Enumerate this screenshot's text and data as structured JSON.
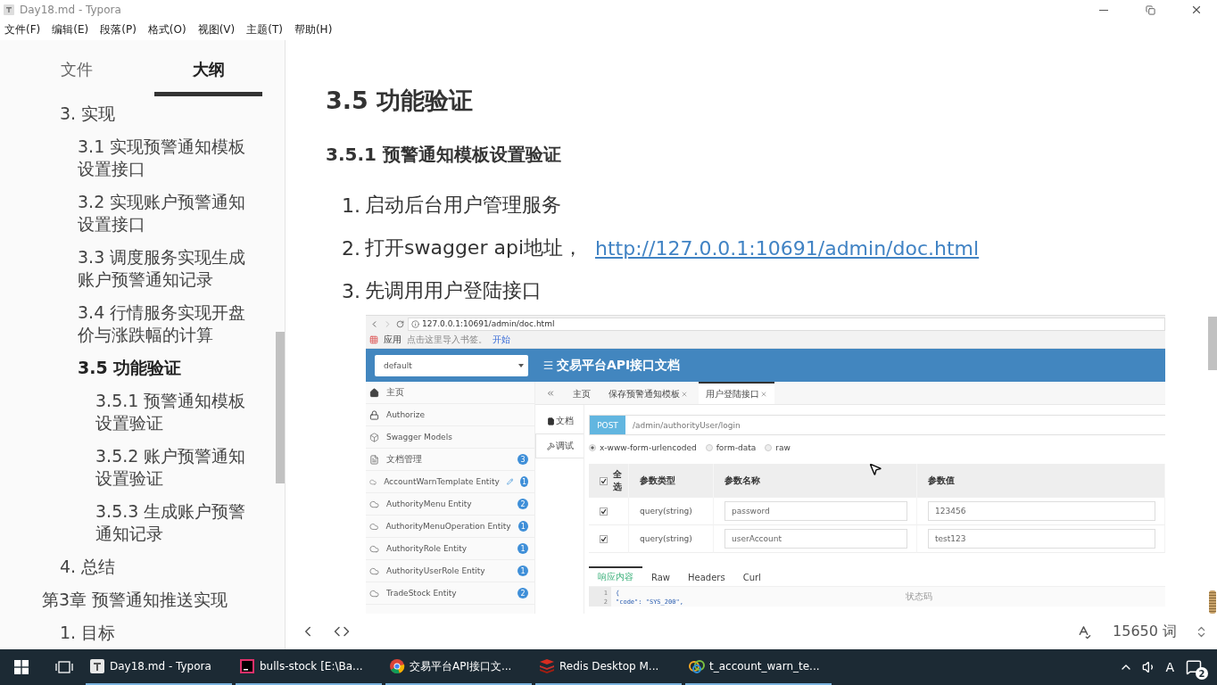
{
  "window": {
    "title": "Day18.md - Typora"
  },
  "menu": [
    "文件(F)",
    "编辑(E)",
    "段落(P)",
    "格式(O)",
    "视图(V)",
    "主题(T)",
    "帮助(H)"
  ],
  "sidebar": {
    "tabs": [
      {
        "label": "文件",
        "selected": false
      },
      {
        "label": "大纲",
        "selected": true
      }
    ],
    "outline": [
      {
        "kind": "section",
        "text": "3. 实现",
        "selected": false,
        "children": [
          {
            "text": "3.1 实现预警通知模板设置接口",
            "selected": false
          },
          {
            "text": "3.2 实现账户预警通知设置接口",
            "selected": false
          },
          {
            "text": "3.3 调度服务实现生成账户预警通知记录",
            "selected": false
          },
          {
            "text": "3.4 行情服务实现开盘价与涨跌幅的计算",
            "selected": false
          },
          {
            "text": "3.5 功能验证",
            "selected": true,
            "children": [
              {
                "text": "3.5.1 预警通知模板设置验证",
                "selected": false
              },
              {
                "text": "3.5.2 账户预警通知设置验证",
                "selected": false
              },
              {
                "text": "3.5.3 生成账户预警通知记录",
                "selected": false
              }
            ]
          }
        ]
      },
      {
        "kind": "section",
        "text": "4. 总结",
        "selected": false
      },
      {
        "kind": "chapter",
        "text": "第3章 预警通知推送实现",
        "selected": false,
        "children": [
          {
            "text": "1. 目标",
            "selected": false
          }
        ]
      }
    ]
  },
  "document": {
    "heading": "3.5  功能验证",
    "subheading": "3.5.1 预警通知模板设置验证",
    "steps": [
      {
        "number": "1.",
        "text": "启动后台用户管理服务"
      },
      {
        "number": "2.",
        "text": "打开swagger api地址，",
        "link": "http://127.0.0.1:10691/admin/doc.html"
      },
      {
        "number": "3.",
        "text": "先调用用户登陆接口"
      }
    ],
    "screenshot": {
      "url": "127.0.0.1:10691/admin/doc.html",
      "bookmarks": {
        "apps": "应用",
        "hint": "点击这里导入书签。",
        "link": "开始"
      },
      "group_select": "default",
      "title": "交易平台API接口文档",
      "menu": [
        {
          "label": "主页",
          "kind": "home",
          "edited": false
        },
        {
          "label": "Authorize",
          "kind": "lock",
          "edited": false
        },
        {
          "label": "Swagger Models",
          "kind": "models",
          "edited": false
        },
        {
          "label": "文档管理",
          "kind": "docs",
          "badge": "3",
          "edited": false
        },
        {
          "label": "AccountWarnTemplate Entity",
          "kind": "entity",
          "badge": "1",
          "edited": true
        },
        {
          "label": "AuthorityMenu Entity",
          "kind": "entity",
          "badge": "2",
          "edited": false
        },
        {
          "label": "AuthorityMenuOperation Entity",
          "kind": "entity",
          "badge": "1",
          "edited": false
        },
        {
          "label": "AuthorityRole Entity",
          "kind": "entity",
          "badge": "1",
          "edited": false
        },
        {
          "label": "AuthorityUserRole Entity",
          "kind": "entity",
          "badge": "1",
          "edited": false
        },
        {
          "label": "TradeStock Entity",
          "kind": "entity",
          "badge": "2",
          "edited": false
        }
      ],
      "tabs": [
        {
          "label": "主页",
          "closable": false,
          "selected": false
        },
        {
          "label": "保存预警通知模板",
          "closable": true,
          "selected": false
        },
        {
          "label": "用户登陆接口",
          "closable": true,
          "selected": true
        }
      ],
      "side_tabs": [
        {
          "label": "文档",
          "kind": "doc",
          "selected": false
        },
        {
          "label": "调试",
          "kind": "debug",
          "selected": true
        }
      ],
      "method": "POST",
      "path": "/admin/authorityUser/login",
      "body_types": [
        {
          "label": "x-www-form-urlencoded",
          "selected": true
        },
        {
          "label": "form-data",
          "selected": false
        },
        {
          "label": "raw",
          "selected": false
        }
      ],
      "params": {
        "columns": [
          "全选",
          "参数类型",
          "参数名称",
          "参数值"
        ],
        "all_checked": true,
        "rows": [
          {
            "checked": true,
            "type": "query(string)",
            "name": "password",
            "value": "123456"
          },
          {
            "checked": true,
            "type": "query(string)",
            "name": "userAccount",
            "value": "test123"
          }
        ]
      },
      "response_tabs": [
        {
          "label": "响应内容",
          "selected": true
        },
        {
          "label": "Raw",
          "selected": false
        },
        {
          "label": "Headers",
          "selected": false
        },
        {
          "label": "Curl",
          "selected": false
        }
      ],
      "code": [
        {
          "line": "1",
          "text": "{"
        },
        {
          "line": "2",
          "text": "\"code\": \"SYS_200\","
        }
      ],
      "comment": "状态码"
    }
  },
  "status_bar": {
    "word_count": "15650 词"
  },
  "taskbar": {
    "apps": [
      {
        "label": "Day18.md - Typora",
        "kind": "typora"
      },
      {
        "label": "bulls-stock [E:\\Ba...",
        "kind": "idea"
      },
      {
        "label": "交易平台API接口文...",
        "kind": "chrome"
      },
      {
        "label": "Redis Desktop M...",
        "kind": "redis"
      },
      {
        "label": "t_account_warn_te...",
        "kind": "navicat"
      }
    ],
    "input_method": "A",
    "notifications": "2"
  }
}
